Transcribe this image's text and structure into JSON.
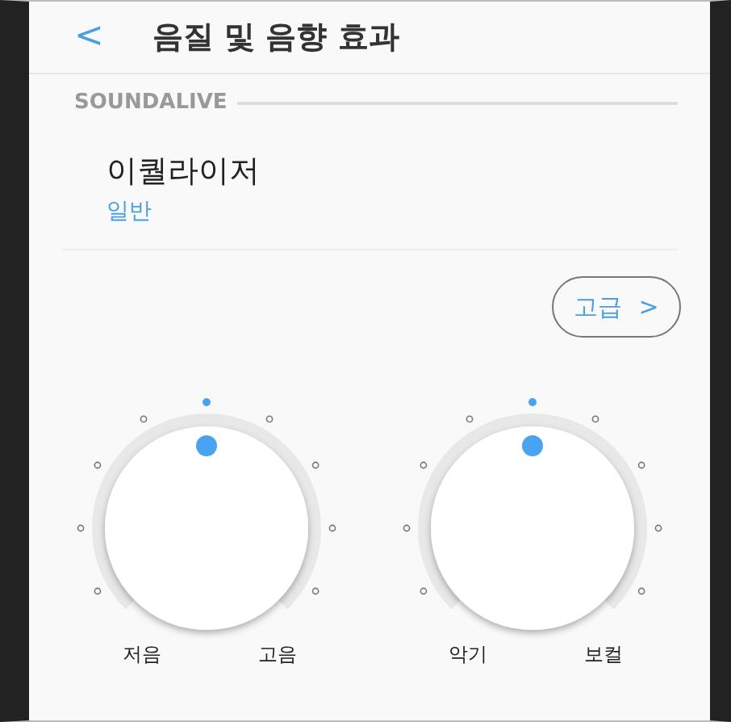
{
  "header": {
    "back": "<",
    "title": "음질 및 음향 효과"
  },
  "section": {
    "title": "SOUNDALIVE"
  },
  "equalizer": {
    "title": "이퀄라이저",
    "value": "일반"
  },
  "advanced_button": {
    "label": "고급",
    "arrow": ">"
  },
  "dials": [
    {
      "level": 0.5,
      "left_label": "저음",
      "right_label": "고음"
    },
    {
      "level": 0.5,
      "left_label": "악기",
      "right_label": "보컬"
    }
  ]
}
